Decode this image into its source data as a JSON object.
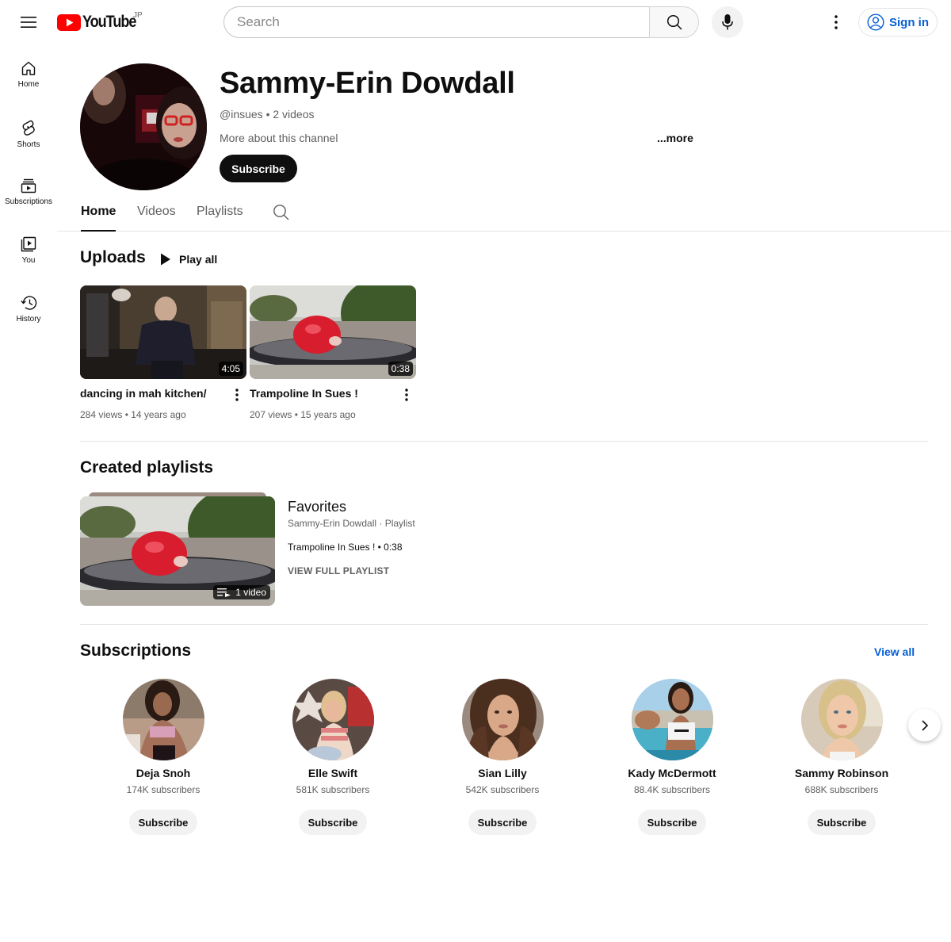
{
  "header": {
    "logo_text": "YouTube",
    "region": "JP",
    "search_placeholder": "Search",
    "sign_in": "Sign in"
  },
  "sidebar": {
    "items": [
      {
        "label": "Home",
        "icon": "home-icon"
      },
      {
        "label": "Shorts",
        "icon": "shorts-icon"
      },
      {
        "label": "Subscriptions",
        "icon": "subscriptions-icon"
      },
      {
        "label": "You",
        "icon": "you-icon"
      },
      {
        "label": "History",
        "icon": "history-icon"
      }
    ]
  },
  "channel": {
    "name": "Sammy-Erin Dowdall",
    "meta": "@insues • 2 videos",
    "about": "More about this channel",
    "more": "...more",
    "subscribe": "Subscribe"
  },
  "tabs": [
    {
      "label": "Home",
      "active": true
    },
    {
      "label": "Videos",
      "active": false
    },
    {
      "label": "Playlists",
      "active": false
    }
  ],
  "uploads": {
    "title": "Uploads",
    "play_all": "Play all",
    "videos": [
      {
        "title": "dancing in mah kitchen/",
        "meta": "284 views • 14 years ago",
        "duration": "4:05"
      },
      {
        "title": "Trampoline In Sues !",
        "meta": "207 views • 15 years ago",
        "duration": "0:38"
      }
    ]
  },
  "playlists": {
    "title": "Created playlists",
    "items": [
      {
        "title": "Favorites",
        "owner": "Sammy-Erin Dowdall · Playlist",
        "first_video": "Trampoline In Sues ! • 0:38",
        "count": "1 video",
        "view_full": "VIEW FULL PLAYLIST"
      }
    ]
  },
  "subscriptions": {
    "title": "Subscriptions",
    "view_all": "View all",
    "channels": [
      {
        "name": "Deja Snoh",
        "subs": "174K subscribers",
        "button": "Subscribe"
      },
      {
        "name": "Elle Swift",
        "subs": "581K subscribers",
        "button": "Subscribe"
      },
      {
        "name": "Sian Lilly",
        "subs": "542K subscribers",
        "button": "Subscribe"
      },
      {
        "name": "Kady McDermott",
        "subs": "88.4K subscribers",
        "button": "Subscribe"
      },
      {
        "name": "Sammy Robinson",
        "subs": "688K subscribers",
        "button": "Subscribe"
      }
    ]
  },
  "colors": {
    "brand_red": "#ff0000",
    "link_blue": "#065fd4",
    "text_primary": "#0f0f0f",
    "text_secondary": "#606060"
  }
}
